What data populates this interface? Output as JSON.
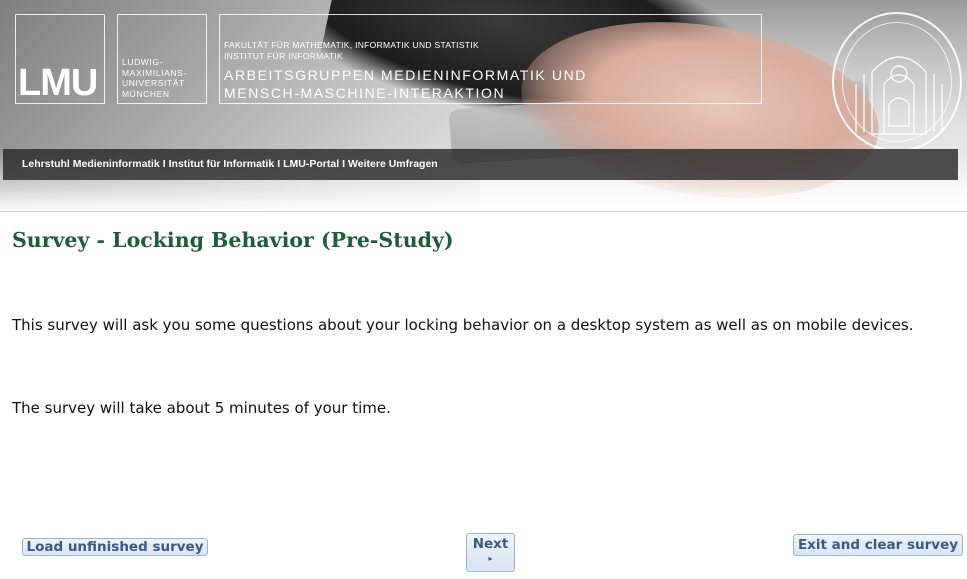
{
  "header": {
    "logo_text": "LMU",
    "university_lines": "LUDWIG-\nMAXIMILIANS-\nUNIVERSITÄT\nMÜNCHEN",
    "faculty_lines": "FAKULTÄT FÜR MATHEMATIK, INFORMATIK UND STATISTIK\nINSTITUT FÜR INFORMATIK",
    "group_lines": "ARBEITSGRUPPEN MEDIENINFORMATIK UND\nMENSCH-MASCHINE-INTERAKTION",
    "nav": {
      "items": [
        "Lehrstuhl Medieninformatik",
        "Institut für Informatik",
        "LMU-Portal",
        "Weitere Umfragen"
      ],
      "separator": "I"
    }
  },
  "survey": {
    "title": "Survey - Locking Behavior (Pre-Study)",
    "intro": "This survey will ask you some questions about your locking behavior on a desktop system as well as on mobile devices.",
    "duration": "The survey will take about 5 minutes of your time."
  },
  "buttons": {
    "load_label": "Load unfinished survey",
    "next_label": "Next",
    "next_arrow": "▸",
    "exit_label": "Exit and clear survey"
  },
  "colors": {
    "title_green": "#1f5c3a",
    "button_text": "#3a5a85",
    "navbar_bg": "#282828"
  }
}
